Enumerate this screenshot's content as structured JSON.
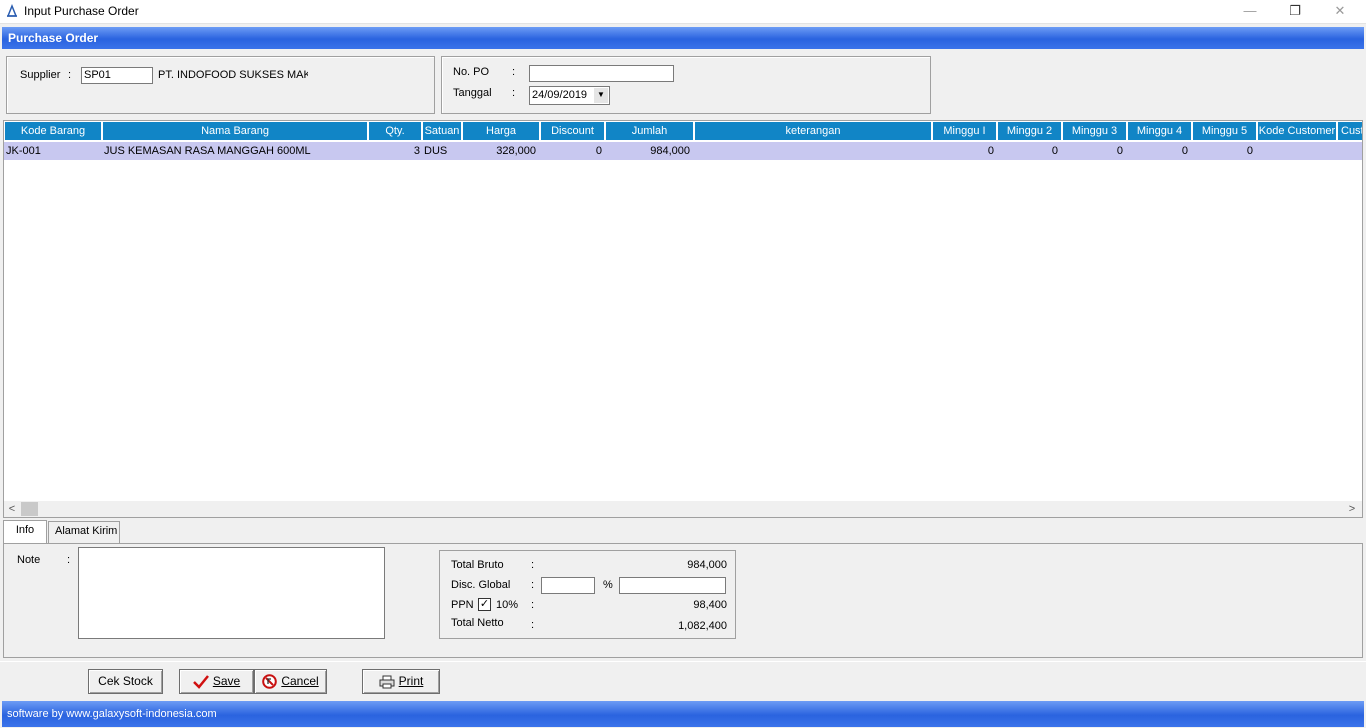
{
  "window": {
    "title": "Input Purchase Order",
    "min": "—",
    "max": "❐",
    "close": "✕"
  },
  "header": {
    "title": "Purchase Order"
  },
  "supplier": {
    "label": "Supplier",
    "colon": ":",
    "code": "SP01",
    "name": "PT. INDOFOOD SUKSES MAKMU"
  },
  "po": {
    "no_label": "No. PO",
    "colon": ":",
    "no_value": "",
    "date_label": "Tanggal",
    "date_value": "24/09/2019",
    "dropdown": "▼"
  },
  "grid": {
    "columns": [
      "Kode Barang",
      "Nama Barang",
      "Qty.",
      "Satuan",
      "Harga",
      "Discount",
      "Jumlah",
      "keterangan",
      "Minggu I",
      "Minggu 2",
      "Minggu 3",
      "Minggu 4",
      "Minggu 5",
      "Kode Customer",
      "Cust"
    ],
    "rows": [
      {
        "kode": "JK-001",
        "nama": "JUS KEMASAN RASA MANGGAH 600ML",
        "qty": "3",
        "satuan": "DUS",
        "harga": "328,000",
        "discount": "0",
        "jumlah": "984,000",
        "keterangan": "",
        "m1": "0",
        "m2": "0",
        "m3": "0",
        "m4": "0",
        "m5": "0",
        "kode_customer": "",
        "cust": ""
      }
    ],
    "scroll_left": "<",
    "scroll_right": ">"
  },
  "tabs": [
    "Info",
    "Alamat Kirim"
  ],
  "info": {
    "note_label": "Note",
    "colon": ":",
    "total_bruto_label": "Total Bruto",
    "total_bruto_value": "984,000",
    "disc_global_label": "Disc. Global",
    "disc_percent_value": "",
    "percent_sign": "%",
    "disc_amount_value": "",
    "ppn_label": "PPN",
    "ppn_checked": "✓",
    "ppn_rate": "10%",
    "ppn_value": "98,400",
    "total_netto_label": "Total Netto",
    "total_netto_value": "1,082,400"
  },
  "buttons": {
    "cek_stock": "Cek Stock",
    "save": "Save",
    "cancel": "Cancel",
    "print": "Print"
  },
  "status": {
    "text": "software by www.galaxysoft-indonesia.com"
  },
  "colors": {
    "header_accent": "#2a63df",
    "grid_header": "#1185c6",
    "selected_row": "#c8c8f0"
  }
}
